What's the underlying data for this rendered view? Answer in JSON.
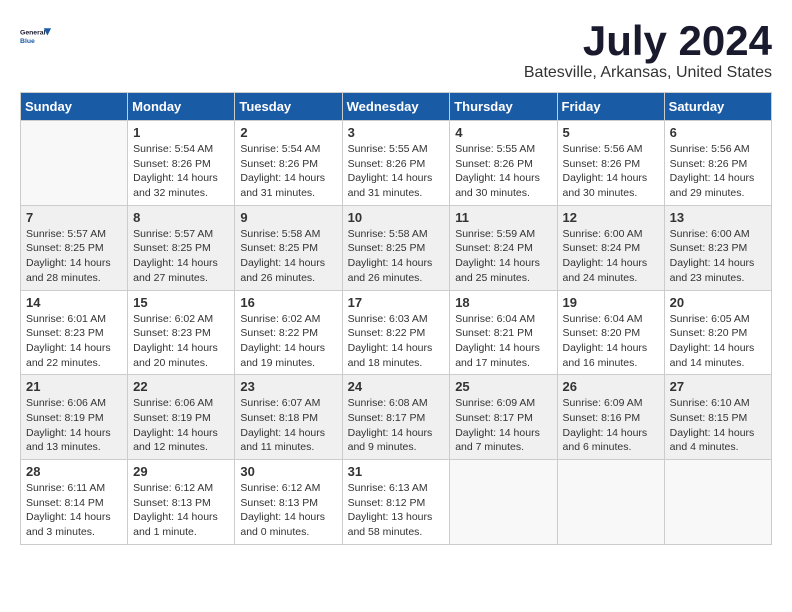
{
  "logo": {
    "line1": "General",
    "line2": "Blue"
  },
  "title": "July 2024",
  "location": "Batesville, Arkansas, United States",
  "days_of_week": [
    "Sunday",
    "Monday",
    "Tuesday",
    "Wednesday",
    "Thursday",
    "Friday",
    "Saturday"
  ],
  "weeks": [
    [
      {
        "day": "",
        "sunrise": "",
        "sunset": "",
        "daylight": ""
      },
      {
        "day": "1",
        "sunrise": "Sunrise: 5:54 AM",
        "sunset": "Sunset: 8:26 PM",
        "daylight": "Daylight: 14 hours and 32 minutes."
      },
      {
        "day": "2",
        "sunrise": "Sunrise: 5:54 AM",
        "sunset": "Sunset: 8:26 PM",
        "daylight": "Daylight: 14 hours and 31 minutes."
      },
      {
        "day": "3",
        "sunrise": "Sunrise: 5:55 AM",
        "sunset": "Sunset: 8:26 PM",
        "daylight": "Daylight: 14 hours and 31 minutes."
      },
      {
        "day": "4",
        "sunrise": "Sunrise: 5:55 AM",
        "sunset": "Sunset: 8:26 PM",
        "daylight": "Daylight: 14 hours and 30 minutes."
      },
      {
        "day": "5",
        "sunrise": "Sunrise: 5:56 AM",
        "sunset": "Sunset: 8:26 PM",
        "daylight": "Daylight: 14 hours and 30 minutes."
      },
      {
        "day": "6",
        "sunrise": "Sunrise: 5:56 AM",
        "sunset": "Sunset: 8:26 PM",
        "daylight": "Daylight: 14 hours and 29 minutes."
      }
    ],
    [
      {
        "day": "7",
        "sunrise": "Sunrise: 5:57 AM",
        "sunset": "Sunset: 8:25 PM",
        "daylight": "Daylight: 14 hours and 28 minutes."
      },
      {
        "day": "8",
        "sunrise": "Sunrise: 5:57 AM",
        "sunset": "Sunset: 8:25 PM",
        "daylight": "Daylight: 14 hours and 27 minutes."
      },
      {
        "day": "9",
        "sunrise": "Sunrise: 5:58 AM",
        "sunset": "Sunset: 8:25 PM",
        "daylight": "Daylight: 14 hours and 26 minutes."
      },
      {
        "day": "10",
        "sunrise": "Sunrise: 5:58 AM",
        "sunset": "Sunset: 8:25 PM",
        "daylight": "Daylight: 14 hours and 26 minutes."
      },
      {
        "day": "11",
        "sunrise": "Sunrise: 5:59 AM",
        "sunset": "Sunset: 8:24 PM",
        "daylight": "Daylight: 14 hours and 25 minutes."
      },
      {
        "day": "12",
        "sunrise": "Sunrise: 6:00 AM",
        "sunset": "Sunset: 8:24 PM",
        "daylight": "Daylight: 14 hours and 24 minutes."
      },
      {
        "day": "13",
        "sunrise": "Sunrise: 6:00 AM",
        "sunset": "Sunset: 8:23 PM",
        "daylight": "Daylight: 14 hours and 23 minutes."
      }
    ],
    [
      {
        "day": "14",
        "sunrise": "Sunrise: 6:01 AM",
        "sunset": "Sunset: 8:23 PM",
        "daylight": "Daylight: 14 hours and 22 minutes."
      },
      {
        "day": "15",
        "sunrise": "Sunrise: 6:02 AM",
        "sunset": "Sunset: 8:23 PM",
        "daylight": "Daylight: 14 hours and 20 minutes."
      },
      {
        "day": "16",
        "sunrise": "Sunrise: 6:02 AM",
        "sunset": "Sunset: 8:22 PM",
        "daylight": "Daylight: 14 hours and 19 minutes."
      },
      {
        "day": "17",
        "sunrise": "Sunrise: 6:03 AM",
        "sunset": "Sunset: 8:22 PM",
        "daylight": "Daylight: 14 hours and 18 minutes."
      },
      {
        "day": "18",
        "sunrise": "Sunrise: 6:04 AM",
        "sunset": "Sunset: 8:21 PM",
        "daylight": "Daylight: 14 hours and 17 minutes."
      },
      {
        "day": "19",
        "sunrise": "Sunrise: 6:04 AM",
        "sunset": "Sunset: 8:20 PM",
        "daylight": "Daylight: 14 hours and 16 minutes."
      },
      {
        "day": "20",
        "sunrise": "Sunrise: 6:05 AM",
        "sunset": "Sunset: 8:20 PM",
        "daylight": "Daylight: 14 hours and 14 minutes."
      }
    ],
    [
      {
        "day": "21",
        "sunrise": "Sunrise: 6:06 AM",
        "sunset": "Sunset: 8:19 PM",
        "daylight": "Daylight: 14 hours and 13 minutes."
      },
      {
        "day": "22",
        "sunrise": "Sunrise: 6:06 AM",
        "sunset": "Sunset: 8:19 PM",
        "daylight": "Daylight: 14 hours and 12 minutes."
      },
      {
        "day": "23",
        "sunrise": "Sunrise: 6:07 AM",
        "sunset": "Sunset: 8:18 PM",
        "daylight": "Daylight: 14 hours and 11 minutes."
      },
      {
        "day": "24",
        "sunrise": "Sunrise: 6:08 AM",
        "sunset": "Sunset: 8:17 PM",
        "daylight": "Daylight: 14 hours and 9 minutes."
      },
      {
        "day": "25",
        "sunrise": "Sunrise: 6:09 AM",
        "sunset": "Sunset: 8:17 PM",
        "daylight": "Daylight: 14 hours and 7 minutes."
      },
      {
        "day": "26",
        "sunrise": "Sunrise: 6:09 AM",
        "sunset": "Sunset: 8:16 PM",
        "daylight": "Daylight: 14 hours and 6 minutes."
      },
      {
        "day": "27",
        "sunrise": "Sunrise: 6:10 AM",
        "sunset": "Sunset: 8:15 PM",
        "daylight": "Daylight: 14 hours and 4 minutes."
      }
    ],
    [
      {
        "day": "28",
        "sunrise": "Sunrise: 6:11 AM",
        "sunset": "Sunset: 8:14 PM",
        "daylight": "Daylight: 14 hours and 3 minutes."
      },
      {
        "day": "29",
        "sunrise": "Sunrise: 6:12 AM",
        "sunset": "Sunset: 8:13 PM",
        "daylight": "Daylight: 14 hours and 1 minute."
      },
      {
        "day": "30",
        "sunrise": "Sunrise: 6:12 AM",
        "sunset": "Sunset: 8:13 PM",
        "daylight": "Daylight: 14 hours and 0 minutes."
      },
      {
        "day": "31",
        "sunrise": "Sunrise: 6:13 AM",
        "sunset": "Sunset: 8:12 PM",
        "daylight": "Daylight: 13 hours and 58 minutes."
      },
      {
        "day": "",
        "sunrise": "",
        "sunset": "",
        "daylight": ""
      },
      {
        "day": "",
        "sunrise": "",
        "sunset": "",
        "daylight": ""
      },
      {
        "day": "",
        "sunrise": "",
        "sunset": "",
        "daylight": ""
      }
    ]
  ]
}
